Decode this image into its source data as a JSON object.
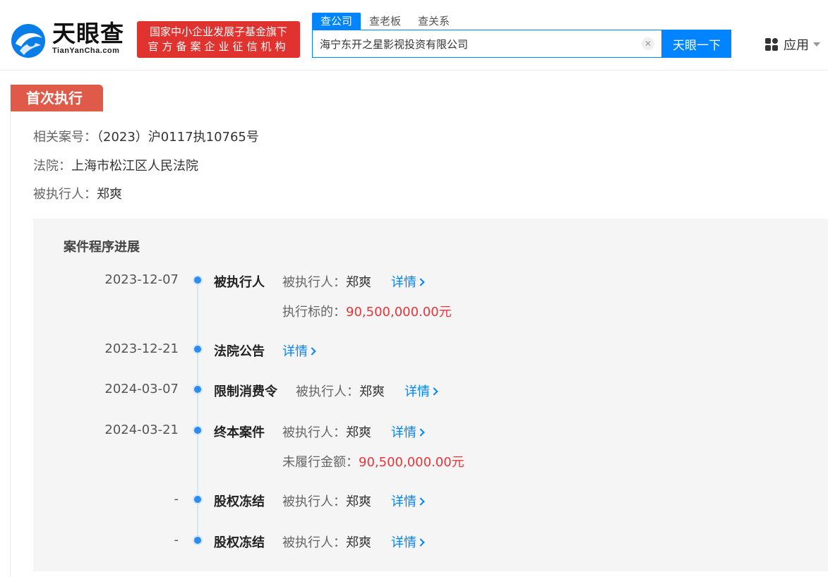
{
  "header": {
    "logo_text": "天眼查",
    "logo_sub": "TianYanCha.com",
    "badge_line1": "国家中小企业发展子基金旗下",
    "badge_line2": "官方备案企业征信机构",
    "search_tabs": [
      {
        "label": "查公司"
      },
      {
        "label": "查老板"
      },
      {
        "label": "查关系"
      }
    ],
    "search_value": "海宁东开之星影视投资有限公司",
    "search_button": "天眼一下",
    "apps_label": "应用",
    "brand_color": "#0084ff"
  },
  "section": {
    "tag": "首次执行",
    "case_label": "相关案号：",
    "case_value": "（2023）沪0117执10765号",
    "court_label": "法院：",
    "court_value": "上海市松江区人民法院",
    "subject_label": "被执行人：",
    "subject_value": "郑爽"
  },
  "progress": {
    "title": "案件程序进展",
    "items": [
      {
        "date": "2023-12-07",
        "title": "被执行人",
        "field_label": "被执行人：",
        "field_value": "郑爽",
        "link": "详情",
        "extra_label": "执行标的：",
        "extra_value": "90,500,000.00元"
      },
      {
        "date": "2023-12-21",
        "title": "法院公告",
        "link": "详情"
      },
      {
        "date": "2024-03-07",
        "title": "限制消费令",
        "field_label": "被执行人：",
        "field_value": "郑爽",
        "link": "详情"
      },
      {
        "date": "2024-03-21",
        "title": "终本案件",
        "field_label": "被执行人：",
        "field_value": "郑爽",
        "link": "详情",
        "extra_label": "未履行金额：",
        "extra_value": "90,500,000.00元"
      },
      {
        "date": "-",
        "title": "股权冻结",
        "field_label": "被执行人：",
        "field_value": "郑爽",
        "link": "详情"
      },
      {
        "date": "-",
        "title": "股权冻结",
        "field_label": "被执行人：",
        "field_value": "郑爽",
        "link": "详情"
      }
    ]
  },
  "colors": {
    "accent_red": "#e05a4a",
    "amount_red": "#e8353a",
    "link_blue": "#0084ff"
  }
}
